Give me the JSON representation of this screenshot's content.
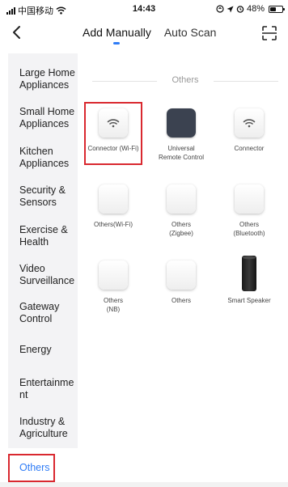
{
  "status_bar": {
    "carrier": "中国移动",
    "time": "14:43",
    "battery_percent": "48%",
    "battery_level": 0.48
  },
  "nav": {
    "tabs": [
      {
        "label": "Add Manually",
        "active": true
      },
      {
        "label": "Auto Scan",
        "active": false
      }
    ]
  },
  "sidebar": {
    "items": [
      {
        "label": "Large Home Appliances"
      },
      {
        "label": "Small Home Appliances"
      },
      {
        "label": "Kitchen Appliances"
      },
      {
        "label": "Security & Sensors"
      },
      {
        "label": "Exercise & Health"
      },
      {
        "label": "Video Surveillance"
      },
      {
        "label": "Gateway Control"
      },
      {
        "label": "Energy"
      },
      {
        "label": "Entertainment"
      },
      {
        "label": "Industry & Agriculture"
      },
      {
        "label": "Others",
        "active": true
      }
    ]
  },
  "main": {
    "section_title": "Others",
    "devices": [
      {
        "name": "Connector (Wi-Fi)",
        "sub": "",
        "icon": "wifi-icon"
      },
      {
        "name": "Universal",
        "sub": "Remote Control",
        "icon": "remote-icon"
      },
      {
        "name": "Connector",
        "sub": "",
        "icon": "wifi-icon"
      },
      {
        "name": "Others(Wi-Fi)",
        "sub": "",
        "icon": "blank-tile"
      },
      {
        "name": "Others",
        "sub": "(Zigbee)",
        "icon": "blank-tile"
      },
      {
        "name": "Others",
        "sub": "(Bluetooth)",
        "icon": "blank-tile"
      },
      {
        "name": "Others",
        "sub": "(NB)",
        "icon": "blank-tile"
      },
      {
        "name": "Others",
        "sub": "",
        "icon": "blank-tile"
      },
      {
        "name": "Smart Speaker",
        "sub": "",
        "icon": "speaker-icon"
      }
    ]
  },
  "colors": {
    "accent": "#2f7cf6",
    "highlight": "#d9282f",
    "sidebar_bg": "#f3f3f5"
  }
}
